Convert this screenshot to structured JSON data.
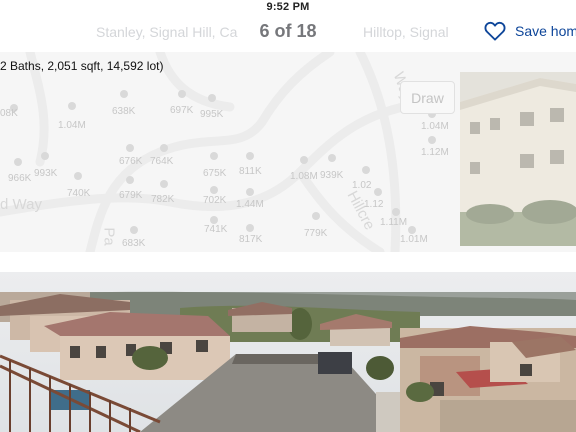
{
  "status_bar": {
    "time": "9:52 PM"
  },
  "nav": {
    "ghost_left": "Stanley, Signal Hill, Ca",
    "ghost_right": "Hilltop, Signal",
    "counter": "6 of 18",
    "save_label": "Save hom",
    "save_icon": "heart-outline-icon",
    "accent_color": "#0d4599"
  },
  "map": {
    "summary": "2 Baths, 2,051 sqft, 14,592 lot)",
    "draw_label": "Draw",
    "streets": [
      "d Way",
      "Hillcre",
      "Pa",
      "Way"
    ],
    "prices": [
      "08K",
      "1.04M",
      "638K",
      "697K",
      "995K",
      "676K",
      "764K",
      "993K",
      "966K",
      "740K",
      "679K",
      "782K",
      "675K",
      "811K",
      "1.08M",
      "939K",
      "1.02",
      "702K",
      "1.44M",
      "1.12",
      "741K",
      "1.11M",
      "817K",
      "779K",
      "683K",
      "1.01M",
      "1.04M",
      "1.12M"
    ]
  },
  "photo": {
    "description_icon": "panorama-photo"
  }
}
